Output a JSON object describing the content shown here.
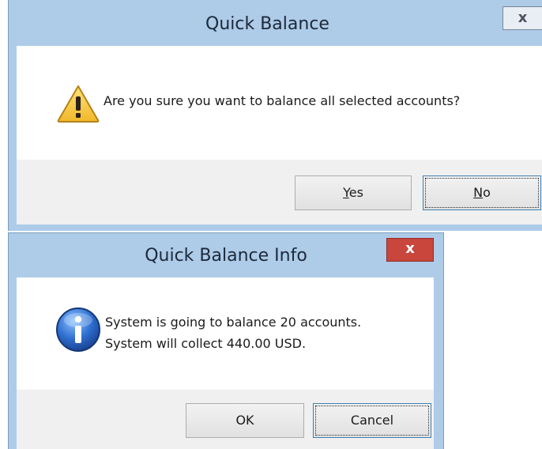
{
  "dialog_confirm": {
    "title": "Quick Balance",
    "close_label": "x",
    "icon": "warning-icon",
    "message": "Are you sure you want to balance all selected accounts?",
    "buttons": {
      "yes_mnemonic": "Y",
      "yes_rest": "es",
      "no_mnemonic": "N",
      "no_rest": "o"
    },
    "colors": {
      "titlebar": "#aecbe8",
      "close_button": "#e9eef4"
    }
  },
  "dialog_info": {
    "title": "Quick Balance Info",
    "close_label": "x",
    "icon": "info-icon",
    "message_lines": [
      "System is going to balance 20 accounts.",
      "System will collect 440.00 USD."
    ],
    "buttons": {
      "ok": "OK",
      "cancel": "Cancel"
    },
    "colors": {
      "titlebar": "#aecbe8",
      "close_button": "#c8463c"
    }
  }
}
